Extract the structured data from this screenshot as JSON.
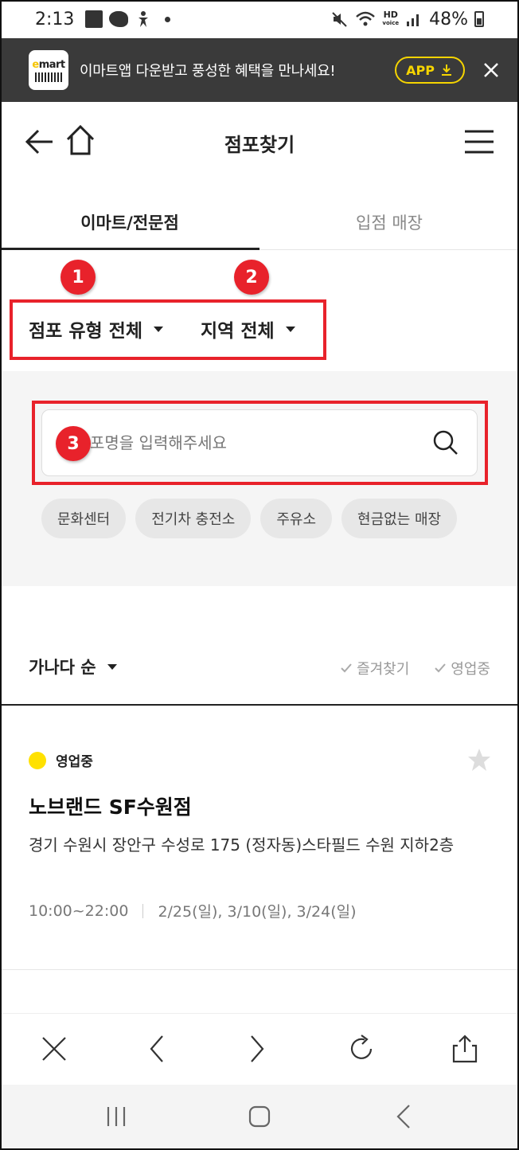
{
  "status_bar": {
    "time": "2:13",
    "hd_label": "HD",
    "voice_label": "voice",
    "battery": "48%"
  },
  "promo": {
    "logo_text_e": "e",
    "logo_text_rest": "mart",
    "message": "이마트앱 다운받고 풍성한 혜택을 만나세요!",
    "app_button": "APP"
  },
  "header": {
    "title": "점포찾기"
  },
  "tabs": [
    {
      "label": "이마트/전문점",
      "active": true
    },
    {
      "label": "입점 매장",
      "active": false
    }
  ],
  "annotations": {
    "badge1": "1",
    "badge2": "2",
    "badge3": "3"
  },
  "filters": {
    "store_type": "점포 유형 전체",
    "region": "지역 전체"
  },
  "search": {
    "placeholder": "포명을 입력해주세요"
  },
  "chips": [
    "문화센터",
    "전기차 충전소",
    "주유소",
    "현금없는 매장"
  ],
  "sort": {
    "label": "가나다 순",
    "favorites": "즐겨찾기",
    "open_now": "영업중"
  },
  "store": {
    "status": "영업중",
    "name": "노브랜드 SF수원점",
    "address": "경기 수원시 장안구 수성로 175 (정자동)스타필드 수원 지하2층",
    "hours": "10:00~22:00",
    "closed_days": "2/25(일), 3/10(일), 3/24(일)"
  },
  "colors": {
    "accent_red": "#e8222b",
    "promo_bg": "#3a3a3a",
    "app_yellow": "#f5d400",
    "open_dot": "#ffe100"
  }
}
